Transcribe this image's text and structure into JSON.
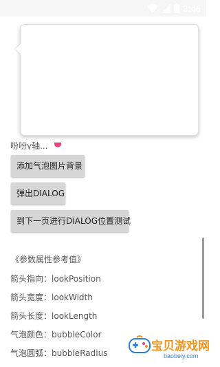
{
  "status_bar": {
    "time": "3:46",
    "icons": [
      "wifi-icon",
      "signal-icon",
      "battery-icon"
    ]
  },
  "partial_text": "吩吩y轴...",
  "buttons": {
    "add_bubble_bg": "添加气泡图片背景",
    "show_dialog": "弹出DIALOG",
    "next_page_test": "到下一页进行DIALOG位置测试"
  },
  "reference": {
    "title": "《参数属性参考值》",
    "items": [
      {
        "key": "箭头指向：",
        "value": "lookPosition"
      },
      {
        "key": "箭头宽度：",
        "value": "lookWidth"
      },
      {
        "key": "箭头长度：",
        "value": "lookLength"
      },
      {
        "key": "气泡颜色：",
        "value": "bubbleColor"
      },
      {
        "key": "气泡圆弧：",
        "value": "bubbleRadius"
      }
    ]
  },
  "watermark": {
    "text": "宝贝游戏网",
    "sub": "baobeiy.com"
  },
  "colors": {
    "accent_pink": "#e8427a",
    "watermark_orange": "#f2931c",
    "watermark_blue": "#2c7fd8"
  }
}
